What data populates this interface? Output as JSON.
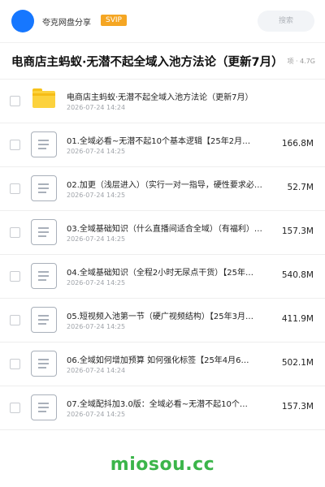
{
  "header": {
    "site_name": "夸克网盘分享",
    "badge": "SVIP",
    "search_placeholder": "搜索"
  },
  "title": {
    "text": "电商店主蚂蚁·无潜不起全域入池方法论（更新7月）",
    "meta": "项 · 4.7G"
  },
  "files": [
    {
      "type": "folder",
      "name": "电商店主蚂蚁·无潜不起全域入池方法论（更新7月）",
      "date": "2026-07-24 14:24",
      "size": ""
    },
    {
      "type": "file",
      "name": "01.全域必看~无潜不起10个基本逻辑【25年2月…",
      "date": "2026-07-24 14:25",
      "size": "166.8M"
    },
    {
      "type": "file",
      "name": "02.加更（浅层进入）（实行一对一指导，硬性要求必…",
      "date": "2026-07-24 14:25",
      "size": "52.7M"
    },
    {
      "type": "file",
      "name": "03.全域基础知识（什么直播间适合全域）（有福利）…",
      "date": "2026-07-24 14:25",
      "size": "157.3M"
    },
    {
      "type": "file",
      "name": "04.全域基础知识（全程2小时无尿点干货）【25年…",
      "date": "2026-07-24 14:25",
      "size": "540.8M"
    },
    {
      "type": "file",
      "name": "05.短视频入池第一节（硬广视频结构）【25年3月…",
      "date": "2026-07-24 14:25",
      "size": "411.9M"
    },
    {
      "type": "file",
      "name": "06.全域如何增加预算 如何强化标签【25年4月6…",
      "date": "2026-07-24 14:24",
      "size": "502.1M"
    },
    {
      "type": "file",
      "name": "07.全域配抖加3.0版：全域必看~无潜不起10个…",
      "date": "2026-07-24 14:25",
      "size": "157.3M"
    }
  ],
  "watermark": "miosou.cc",
  "colors": {
    "accent": "#1677ff",
    "svip": "#f5a623",
    "folder": "#fcd23d",
    "watermark": "#3bb54a"
  }
}
